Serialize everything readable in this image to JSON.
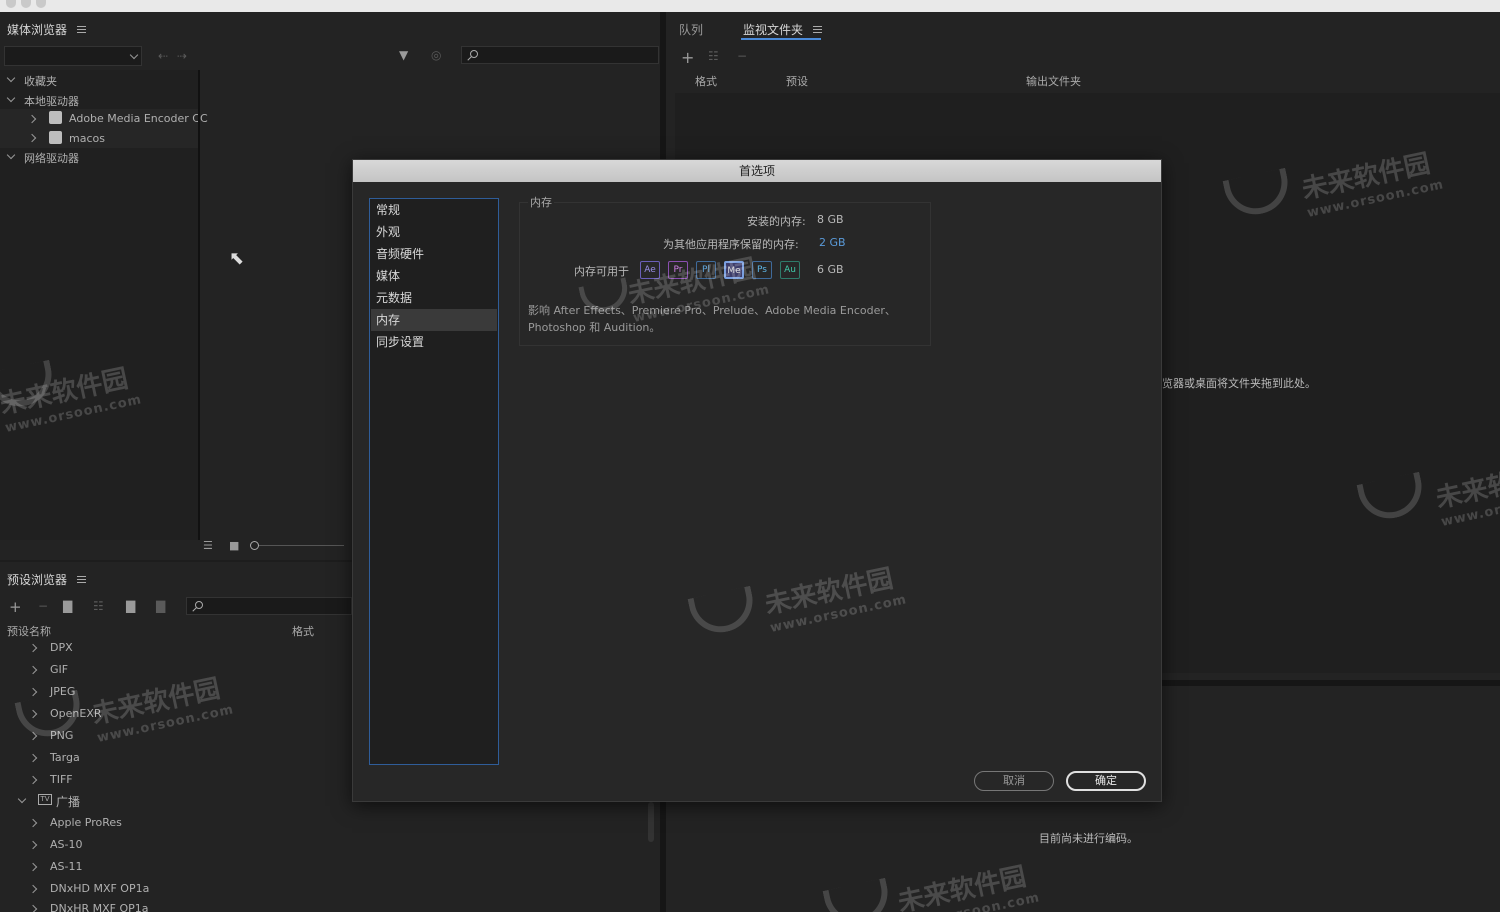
{
  "media_browser": {
    "title": "媒体浏览器",
    "tree": {
      "favorites": "收藏夹",
      "local_drives": "本地驱动器",
      "drive1": "Adobe Media Encoder CC",
      "drive2": "macos",
      "network_drives": "网络驱动器"
    }
  },
  "preset_browser": {
    "title": "预设浏览器",
    "col_name": "预设名称",
    "col_format": "格式",
    "items": [
      "DPX",
      "GIF",
      "JPEG",
      "OpenEXR",
      "PNG",
      "Targa",
      "TIFF"
    ],
    "group_broadcast": "广播",
    "broadcast_items": [
      "Apple ProRes",
      "AS-10",
      "AS-11",
      "DNxHD MXF OP1a",
      "DNxHR MXF OP1a"
    ]
  },
  "queue_panel": {
    "tab_queue": "队列",
    "tab_watch": "监视文件夹",
    "col_format": "格式",
    "col_preset": "预设",
    "col_output": "输出文件夹",
    "hint": "览器或桌面将文件夹拖到此处。"
  },
  "encoding_panel": {
    "status": "目前尚未进行编码。"
  },
  "dialog": {
    "title": "首选项",
    "categories": [
      "常规",
      "外观",
      "音频硬件",
      "媒体",
      "元数据",
      "内存",
      "同步设置"
    ],
    "group_title": "内存",
    "installed_label": "安装的内存:",
    "installed_value": "8 GB",
    "reserved_label": "为其他应用程序保留的内存:",
    "reserved_value": "2 GB",
    "available_label": "内存可用于",
    "available_value": "6 GB",
    "apps": [
      "Ae",
      "Pr",
      "Pl",
      "Me",
      "Ps",
      "Au"
    ],
    "affect_text": "影响 After Effects、Premiere Pro、Prelude、Adobe Media Encoder、Photoshop 和 Audition。",
    "cancel": "取消",
    "ok": "确定"
  },
  "watermark": {
    "cn": "未来软件园",
    "url": "www.orsoon.com"
  },
  "colors": {
    "accent_blue": "#2f5d99",
    "link_blue": "#5a9ad8",
    "panel_bg": "#232323"
  }
}
